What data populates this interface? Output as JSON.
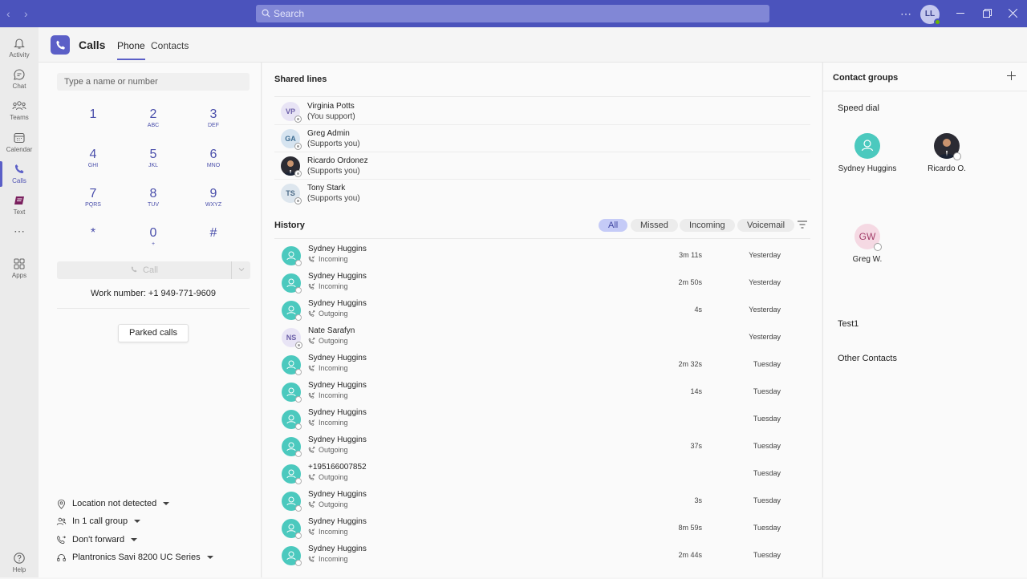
{
  "titlebar": {
    "search_placeholder": "Search",
    "user_initials": "LL"
  },
  "rail": [
    {
      "label": "Activity"
    },
    {
      "label": "Chat"
    },
    {
      "label": "Teams"
    },
    {
      "label": "Calendar"
    },
    {
      "label": "Calls"
    },
    {
      "label": "Text"
    },
    {
      "label": "Apps"
    },
    {
      "label": "Help"
    }
  ],
  "header": {
    "title": "Calls",
    "tabs": [
      "Phone",
      "Contacts"
    ]
  },
  "dialpad": {
    "placeholder": "Type a name or number",
    "keys": [
      {
        "d": "1",
        "l": ""
      },
      {
        "d": "2",
        "l": "ABC"
      },
      {
        "d": "3",
        "l": "DEF"
      },
      {
        "d": "4",
        "l": "GHI"
      },
      {
        "d": "5",
        "l": "JKL"
      },
      {
        "d": "6",
        "l": "MNO"
      },
      {
        "d": "7",
        "l": "PQRS"
      },
      {
        "d": "8",
        "l": "TUV"
      },
      {
        "d": "9",
        "l": "WXYZ"
      },
      {
        "d": "*",
        "l": ""
      },
      {
        "d": "0",
        "l": "+"
      },
      {
        "d": "#",
        "l": ""
      }
    ],
    "call_label": "Call",
    "work_number": "Work number: +1 949-771-9609",
    "parked_label": "Parked calls"
  },
  "options": {
    "location": "Location not detected",
    "call_group": "In 1 call group",
    "forward": "Don't forward",
    "device": "Plantronics Savi 8200 UC Series"
  },
  "shared_lines": {
    "title": "Shared lines",
    "items": [
      {
        "initials": "VP",
        "name": "Virginia Potts",
        "sub": "(You support)"
      },
      {
        "initials": "GA",
        "name": "Greg Admin",
        "sub": "(Supports you)"
      },
      {
        "initials": "",
        "name": "Ricardo Ordonez",
        "sub": "(Supports you)"
      },
      {
        "initials": "TS",
        "name": "Tony Stark",
        "sub": "(Supports you)"
      }
    ]
  },
  "history": {
    "title": "History",
    "filters": [
      "All",
      "Missed",
      "Incoming",
      "Voicemail"
    ],
    "rows": [
      {
        "name": "Sydney Huggins",
        "dir": "Incoming",
        "dur": "3m 11s",
        "day": "Yesterday"
      },
      {
        "name": "Sydney Huggins",
        "dir": "Incoming",
        "dur": "2m 50s",
        "day": "Yesterday"
      },
      {
        "name": "Sydney Huggins",
        "dir": "Outgoing",
        "dur": "4s",
        "day": "Yesterday"
      },
      {
        "name": "Nate Sarafyn",
        "initials": "NS",
        "dir": "Outgoing",
        "dur": "",
        "day": "Yesterday"
      },
      {
        "name": "Sydney Huggins",
        "dir": "Incoming",
        "dur": "2m 32s",
        "day": "Tuesday"
      },
      {
        "name": "Sydney Huggins",
        "dir": "Incoming",
        "dur": "14s",
        "day": "Tuesday"
      },
      {
        "name": "Sydney Huggins",
        "dir": "Incoming",
        "dur": "",
        "day": "Tuesday"
      },
      {
        "name": "Sydney Huggins",
        "dir": "Outgoing",
        "dur": "37s",
        "day": "Tuesday"
      },
      {
        "name": "+195166007852",
        "dir": "Outgoing",
        "dur": "",
        "day": "Tuesday"
      },
      {
        "name": "Sydney Huggins",
        "dir": "Outgoing",
        "dur": "3s",
        "day": "Tuesday"
      },
      {
        "name": "Sydney Huggins",
        "dir": "Incoming",
        "dur": "8m 59s",
        "day": "Tuesday"
      },
      {
        "name": "Sydney Huggins",
        "dir": "Incoming",
        "dur": "2m 44s",
        "day": "Tuesday"
      }
    ]
  },
  "contact_groups": {
    "title": "Contact groups",
    "speed_dial_title": "Speed dial",
    "speed_dial": [
      {
        "name": "Sydney Huggins"
      },
      {
        "name": "Ricardo O."
      },
      {
        "name": "Greg W.",
        "initials": "GW"
      }
    ],
    "groups": [
      "Test1",
      "Other Contacts"
    ]
  },
  "colors": {
    "brand": "#4b53bc",
    "accent": "#5b5fc7",
    "teal_avatar": "#4bc9be"
  }
}
